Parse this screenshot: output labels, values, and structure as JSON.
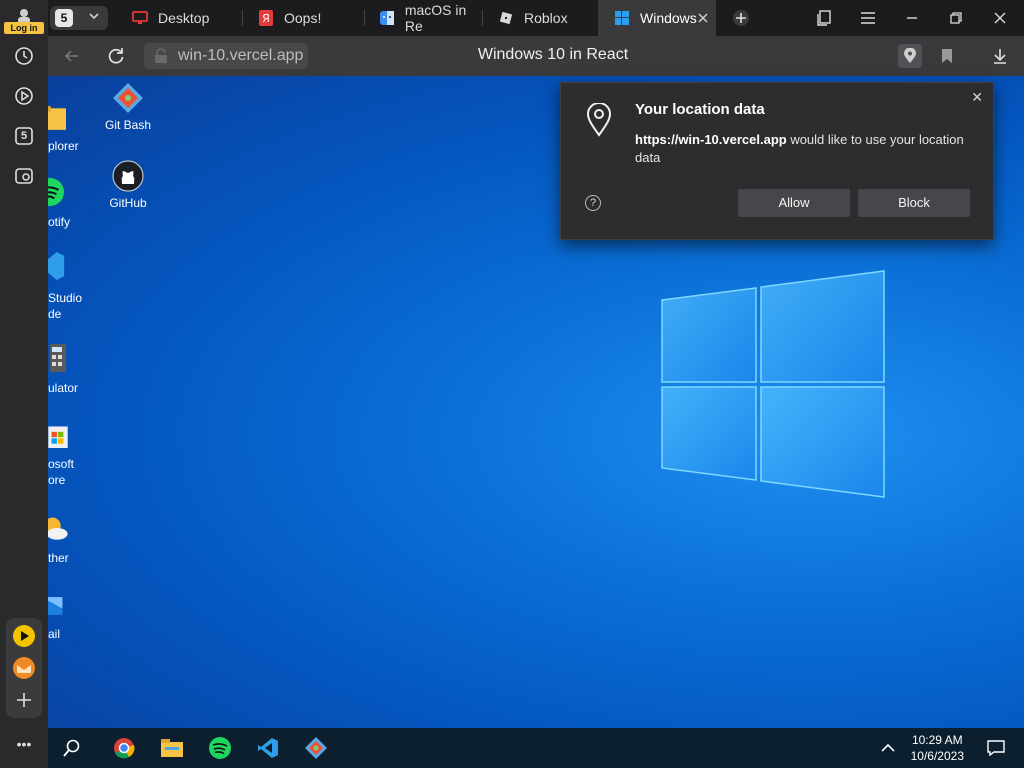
{
  "sidebar": {
    "login_label": "Log in",
    "tab_count": "5"
  },
  "tabs": {
    "count": "5",
    "items": [
      {
        "label": "Desktop",
        "icon": "monitor-icon"
      },
      {
        "label": "Oops!",
        "icon": "yandex-icon"
      },
      {
        "label": "macOS in Re",
        "icon": "finder-icon"
      },
      {
        "label": "Roblox",
        "icon": "roblox-icon"
      },
      {
        "label": "Windows",
        "icon": "windows-icon",
        "active": true
      }
    ]
  },
  "address": {
    "url": "win-10.vercel.app",
    "page_title": "Windows 10 in React"
  },
  "desktop": {
    "icons_right": [
      {
        "label": "Git Bash"
      },
      {
        "label": "GitHub"
      }
    ],
    "icons_left": [
      {
        "label": "plorer"
      },
      {
        "label": "otify"
      },
      {
        "label_1": "Studio",
        "label_2": "de"
      },
      {
        "label": "ulator"
      },
      {
        "label_1": "osoft",
        "label_2": "ore"
      },
      {
        "label": "ther"
      },
      {
        "label": "ail"
      }
    ]
  },
  "popup": {
    "title": "Your location data",
    "site": "https://win-10.vercel.app",
    "message": " would like to use your location data",
    "allow_label": "Allow",
    "block_label": "Block",
    "help_glyph": "?",
    "close_glyph": "✕"
  },
  "taskbar": {
    "time": "10:29 AM",
    "date": "10/6/2023"
  },
  "colors": {
    "accent_login": "#f5c242",
    "desktop_blue": "#0a6fd6",
    "taskbar": "#0c1f2e"
  }
}
